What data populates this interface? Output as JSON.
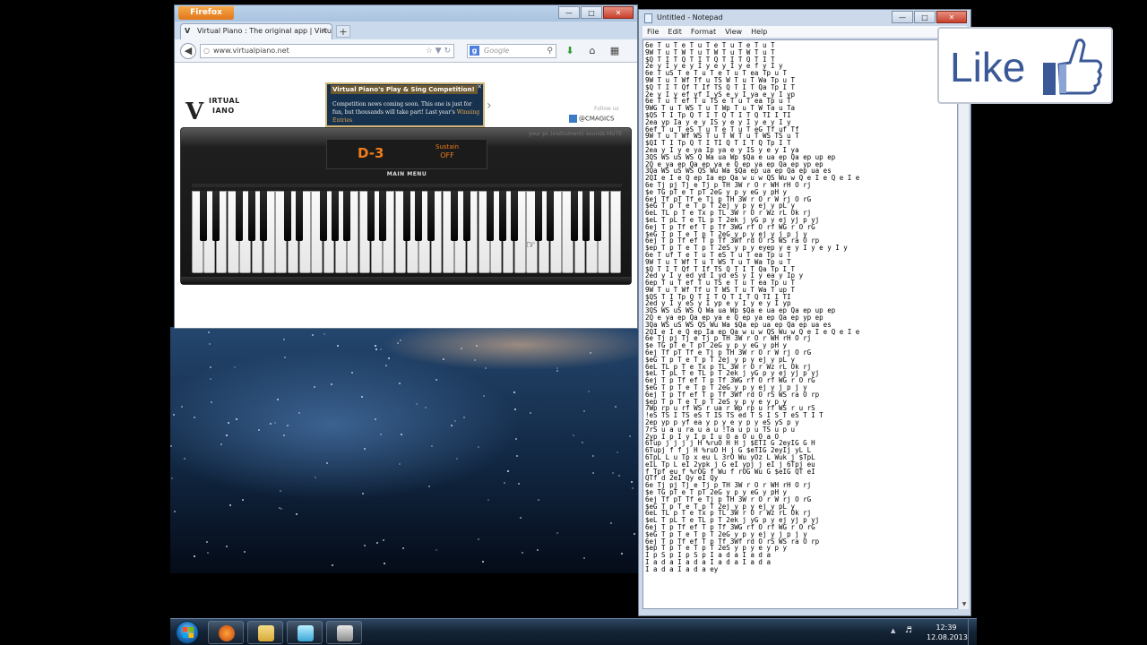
{
  "firefox": {
    "menu_label": "Firefox",
    "tab_title": "Virtual Piano : The original app | Virtual ...",
    "url": "www.virtualpiano.net",
    "search_placeholder": "Google"
  },
  "site": {
    "logo_line1": "IRTUAL",
    "logo_line2": "IANO",
    "comp_title": "Virtual Piano's Play & Sing Competition!",
    "comp_text": "Competition news coming soon. This one is just for fun, but thousands will take part! Last year's",
    "comp_link": "Winning Entries",
    "twitter": "@CMAGICS",
    "follow_text": "Follow us",
    "top_text": "your pc (instrument) sounds   MUTE",
    "note_display": "D-3",
    "sustain_label": "Sustain",
    "sustain_value": "OFF",
    "main_menu": "MAIN MENU"
  },
  "notepad": {
    "title": "Untitled - Notepad",
    "menu": [
      "File",
      "Edit",
      "Format",
      "View",
      "Help"
    ],
    "lines": [
      "6e T u T e T u T e T u T e T u T",
      "9W T u T W T u T W T u T W T u T",
      "$Q T I T Q T I T Q T I T Q T I T",
      "2e y I y e y I y e y I y e f y I y",
      "6e T uS T e T u T e T u T ea Tp u T",
      "9W T u T Wf Tf u TS W T u T Wa Tp u T",
      "$Q T I T Qf T If TS Q T I T Qa Tp I T",
      "2e y I y ef yf I yS e y I ya e y I yp",
      "6e T u T ef T u TS e T u T ea Tp u T",
      "9WG T u T WS T u T Wp T u T W Ta u Ta",
      "$QS T I Tp Q T I T Q T I T Q TI I TI",
      "2ea yp Ia y e y IS y e y I y e y I y",
      "6ef T u T eS T u T e T u T eG Tf uf Tf",
      "9W T u T Wf WS T u T W T u T WS TS u T",
      "$QI T I Tp Q T I TI Q T I T Q Tp I T",
      "2ea y I y e ya Ip ya e y IS y e y I ya",
      "3QS WS uS WS Q Wa ua Wp $Qa e ua ep Qa ep up ep",
      "2Q e ya ep Qa ep ya e Q ep ya ep Qa ep yp ep",
      "3Qa WS uS WS QS Wu Wa $Qa ep ua ep Qa ep ua es",
      "2QI e I e Q ep Ia ep Qa w u w QS Wu w Q e I e Q e I e",
      "6e Tj pj Tj e Tj p TH 3W r O r WH rH O rj",
      "$e TG pT e T pT 2eG y p y eG y pH y",
      "6ej Tf pT Tf e Tj p TH 3W r O r W rj O rG",
      "$eG T p T e T p T 2ej y p y ej y pL y",
      "6eL TL p T e Tx p TL 3W r O r Wz rL Ok rj",
      "$eL T pL T e TL p T 2ek j yG p y ej yj p yj",
      "6ej T p Tf ef T p Tf 3WG rf O rf WG r O rG",
      "$eG T p T e T p T 2eG y p y ej y j p j y",
      "6ej T p Tf ef T p Tf 3Wf rd O rS WS ra O rp",
      "$ep T p T e T p T 2eS y p y eyep y e y I y e y I y",
      "6e T uf T e T u T eS T u T ea Tp u T",
      "9W T u T Wf T u T WS T u T Wa Tp u T",
      "$Q T I T Qf T If TS Q T I T Qa Tp I T",
      "2ed y I y ed yd I yd eS y I y ea y Ip y",
      "6ep T u T ef T u TS e T u T ea Tp u T",
      "9W T u T Wf Tf u T WS T u T Wa T up T",
      "$QS T I Tp Q T I T Q T I T Q TI I TI",
      "2ed y I y eS y I yp e y I y e y I yp",
      "3QS WS uS WS Q Wa ua Wp $Qa e ua ep Qa ep up ep",
      "2Q e ya ep Qa ep ya e Q ep ya ep Qa ep yp ep",
      "3Qa WS uS WS QS Wu Wa $Qa ep ua ep Qa ep ua es",
      "2QI e I e Q ep Ia ep Qa w u w QS Wu w Q e I e Q e I e",
      "6e Tj pj Tj e Tj p TH 3W r O r WH rH O rj",
      "$e TG pT e T pT 2eG y p y eG y pH y",
      "6ej Tf pT Tf e Tj p TH 3W r O r W rj O rG",
      "$eG T p T e T p T 2ej y p y ej y pL y",
      "6eL TL p T e Tx p TL 3W r O r Wz rL Ok rj",
      "$eL T pL T e TL p T 2ek j yG p y ej yj p yj",
      "6ej T p Tf ef T p Tf 3WG rf O rf WG r O rG",
      "$eG T p T e T p T 2eG y p y ej y j p j y",
      "6ej T p Tf ef T p Tf 3Wf rd O rS WS ra O rp",
      "$ep T p T e T p T 2eS y p y e y p y",
      "7Wp rp u rf WS r ua r Wp rp u rf WS r u rS",
      "!eS TS I TS eS T IS TS ed T S I S T eS T I T",
      "2ep yp p yf ea y p y e y p y eS yS p y",
      "7rS u a u ra u a u !Ta u p u TS u p u",
      "2yp I p I y I p I u O a O u O a O",
      "6Tup j j j j H %ruO H H j $ETI G 2eyIG G H",
      "6Tupj f f j H %ruO H j G $eTIG 2eyIj yL L",
      "6TpL L u Tp x eu L 3rO Wu yOz L Wuk j $TpL",
      "eIL Tp L eI 2ypk j G eI ypj j eI j 6Tpj eu",
      "f Tpf eu f %rOG f Wu f rOG Wu G $eIG QT eI",
      "QTf d 2eI Qy eI Qy",
      "6e Tj pj Tj e Tj p TH 3W r O r WH rH O rj",
      "$e TG pT e T pT 2eG y p y eG y pH y",
      "6ej Tf pT Tf e Tj p TH 3W r O r W rj O rG",
      "$eG T p T e T p T 2ej y p y ej y pL y",
      "6eL TL p T e Tx p TL 3W r O r Wz rL Ok rj",
      "$eL T pL T e TL p T 2ek j yG p y ej yj p yj",
      "6ej T p Tf ef T p Tf 3WG rf O rf WG r O rG",
      "$eG T p T e T p T 2eG y p y ej y j p j y",
      "6ej T p Tf ef T p Tf 3Wf rd O rS WS ra O rp",
      "$ep T p T e T p T 2eS y p y e y p y",
      "I p S p I p S p I a d a I a d a",
      "I a d a I a d a I a d a I a d a",
      "I a d a I a d a ey"
    ]
  },
  "like": {
    "label": "Like"
  },
  "taskbar": {
    "time": "12:39",
    "date": "12.08.2013"
  }
}
